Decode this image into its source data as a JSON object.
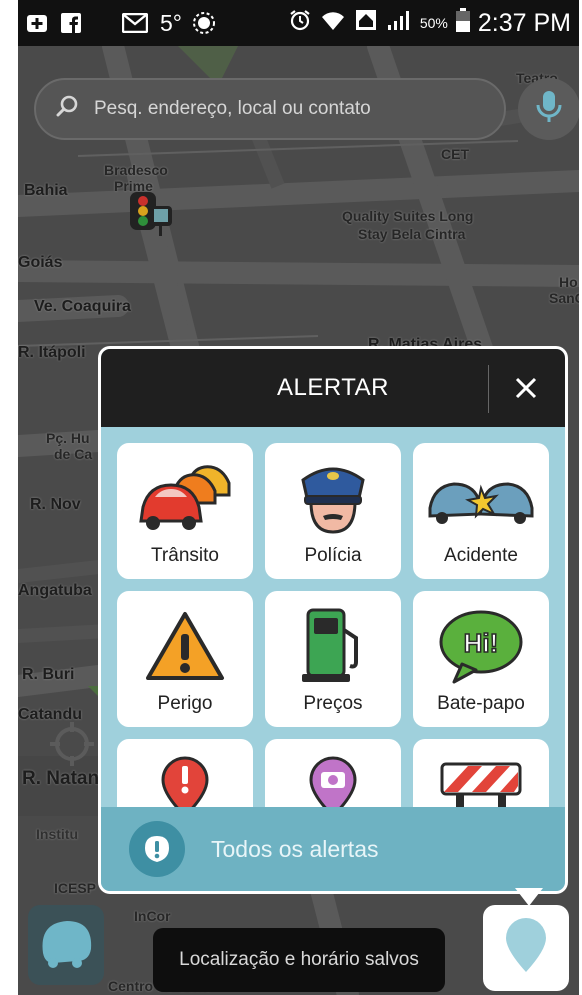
{
  "status_bar": {
    "icons": [
      "plus-icon",
      "facebook-icon",
      "gmail-icon"
    ],
    "temperature": "5°",
    "time": "2:37 PM",
    "battery": "50%"
  },
  "search": {
    "placeholder": "Pesq. endereço, local ou contato"
  },
  "map": {
    "labels": {
      "teatro": "Teatro",
      "cet": "CET",
      "bradesco": "Bradesco",
      "prime": "Prime",
      "bahia": "Bahia",
      "quality1": "Quality Suites Long",
      "quality2": "Stay Bela Cintra",
      "goias": "Goiás",
      "coaquira": "Ve. Coaquira",
      "itapoli": "R. Itápoli",
      "matias": "R. Matias Aires",
      "ho": "Ho",
      "sang": "SanG",
      "pchu": "Pç. Hu",
      "deca": "de Ca",
      "rnov": "R. Nov",
      "angatuba": "Angatuba",
      "rburi": "R. Buri",
      "catandu": "Catandu",
      "natan": "R. Natan",
      "institu": "Institu",
      "icesp": "ICESP",
      "incor": "InCor",
      "centro": "Centro de Conv"
    }
  },
  "dialog": {
    "title": "ALERTAR",
    "tiles": [
      {
        "label": "Trânsito",
        "icon": "traffic-icon"
      },
      {
        "label": "Polícia",
        "icon": "police-icon"
      },
      {
        "label": "Acidente",
        "icon": "accident-icon"
      },
      {
        "label": "Perigo",
        "icon": "hazard-icon"
      },
      {
        "label": "Preços",
        "icon": "gas-price-icon"
      },
      {
        "label": "Bate-papo",
        "icon": "chat-icon"
      },
      {
        "label": "",
        "icon": "map-issue-icon"
      },
      {
        "label": "",
        "icon": "camera-icon"
      },
      {
        "label": "",
        "icon": "road-closure-icon"
      }
    ],
    "all_alerts": "Todos os alertas"
  },
  "toast": "Localização e horário salvos",
  "colors": {
    "dialog_bg": "#9fd0dc",
    "header_bg": "#1f1f1f",
    "footer_bg": "#6eb2c2"
  }
}
